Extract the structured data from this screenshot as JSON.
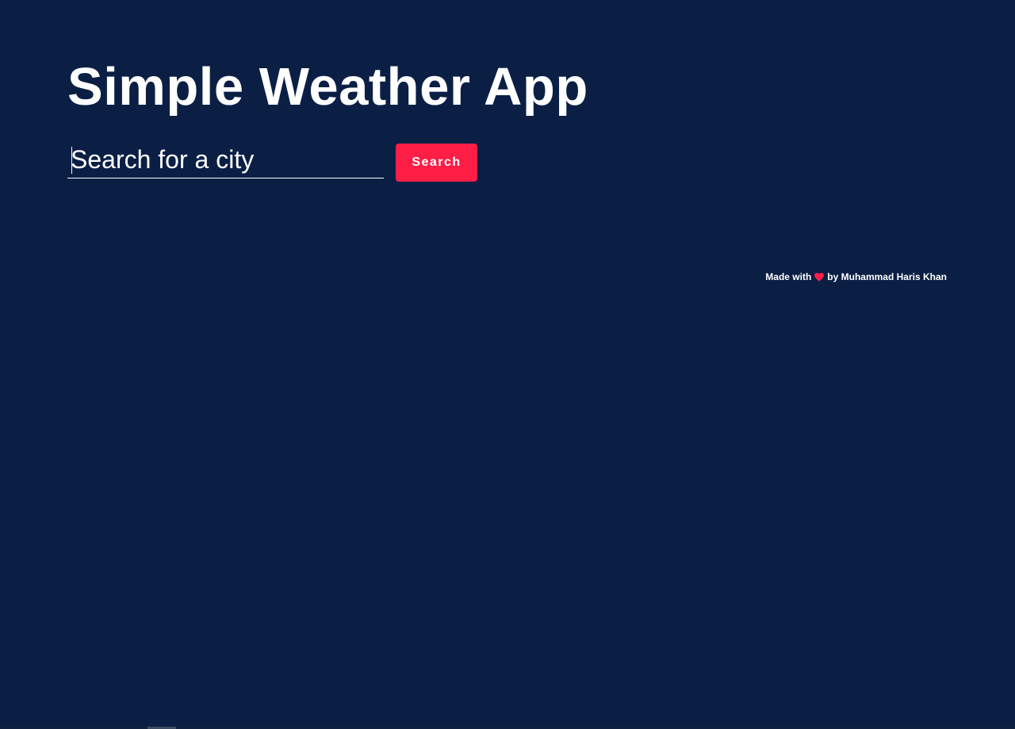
{
  "app": {
    "title": "Simple Weather App"
  },
  "search": {
    "placeholder": "Search for a city",
    "value": "",
    "button_label": "Search"
  },
  "footer": {
    "made_with": "Made with",
    "heart_icon": "heart-icon",
    "by_author": "by Muhammad Haris Khan"
  },
  "colors": {
    "background": "#0b1f45",
    "accent": "#ff1e46",
    "text": "#ffffff"
  }
}
